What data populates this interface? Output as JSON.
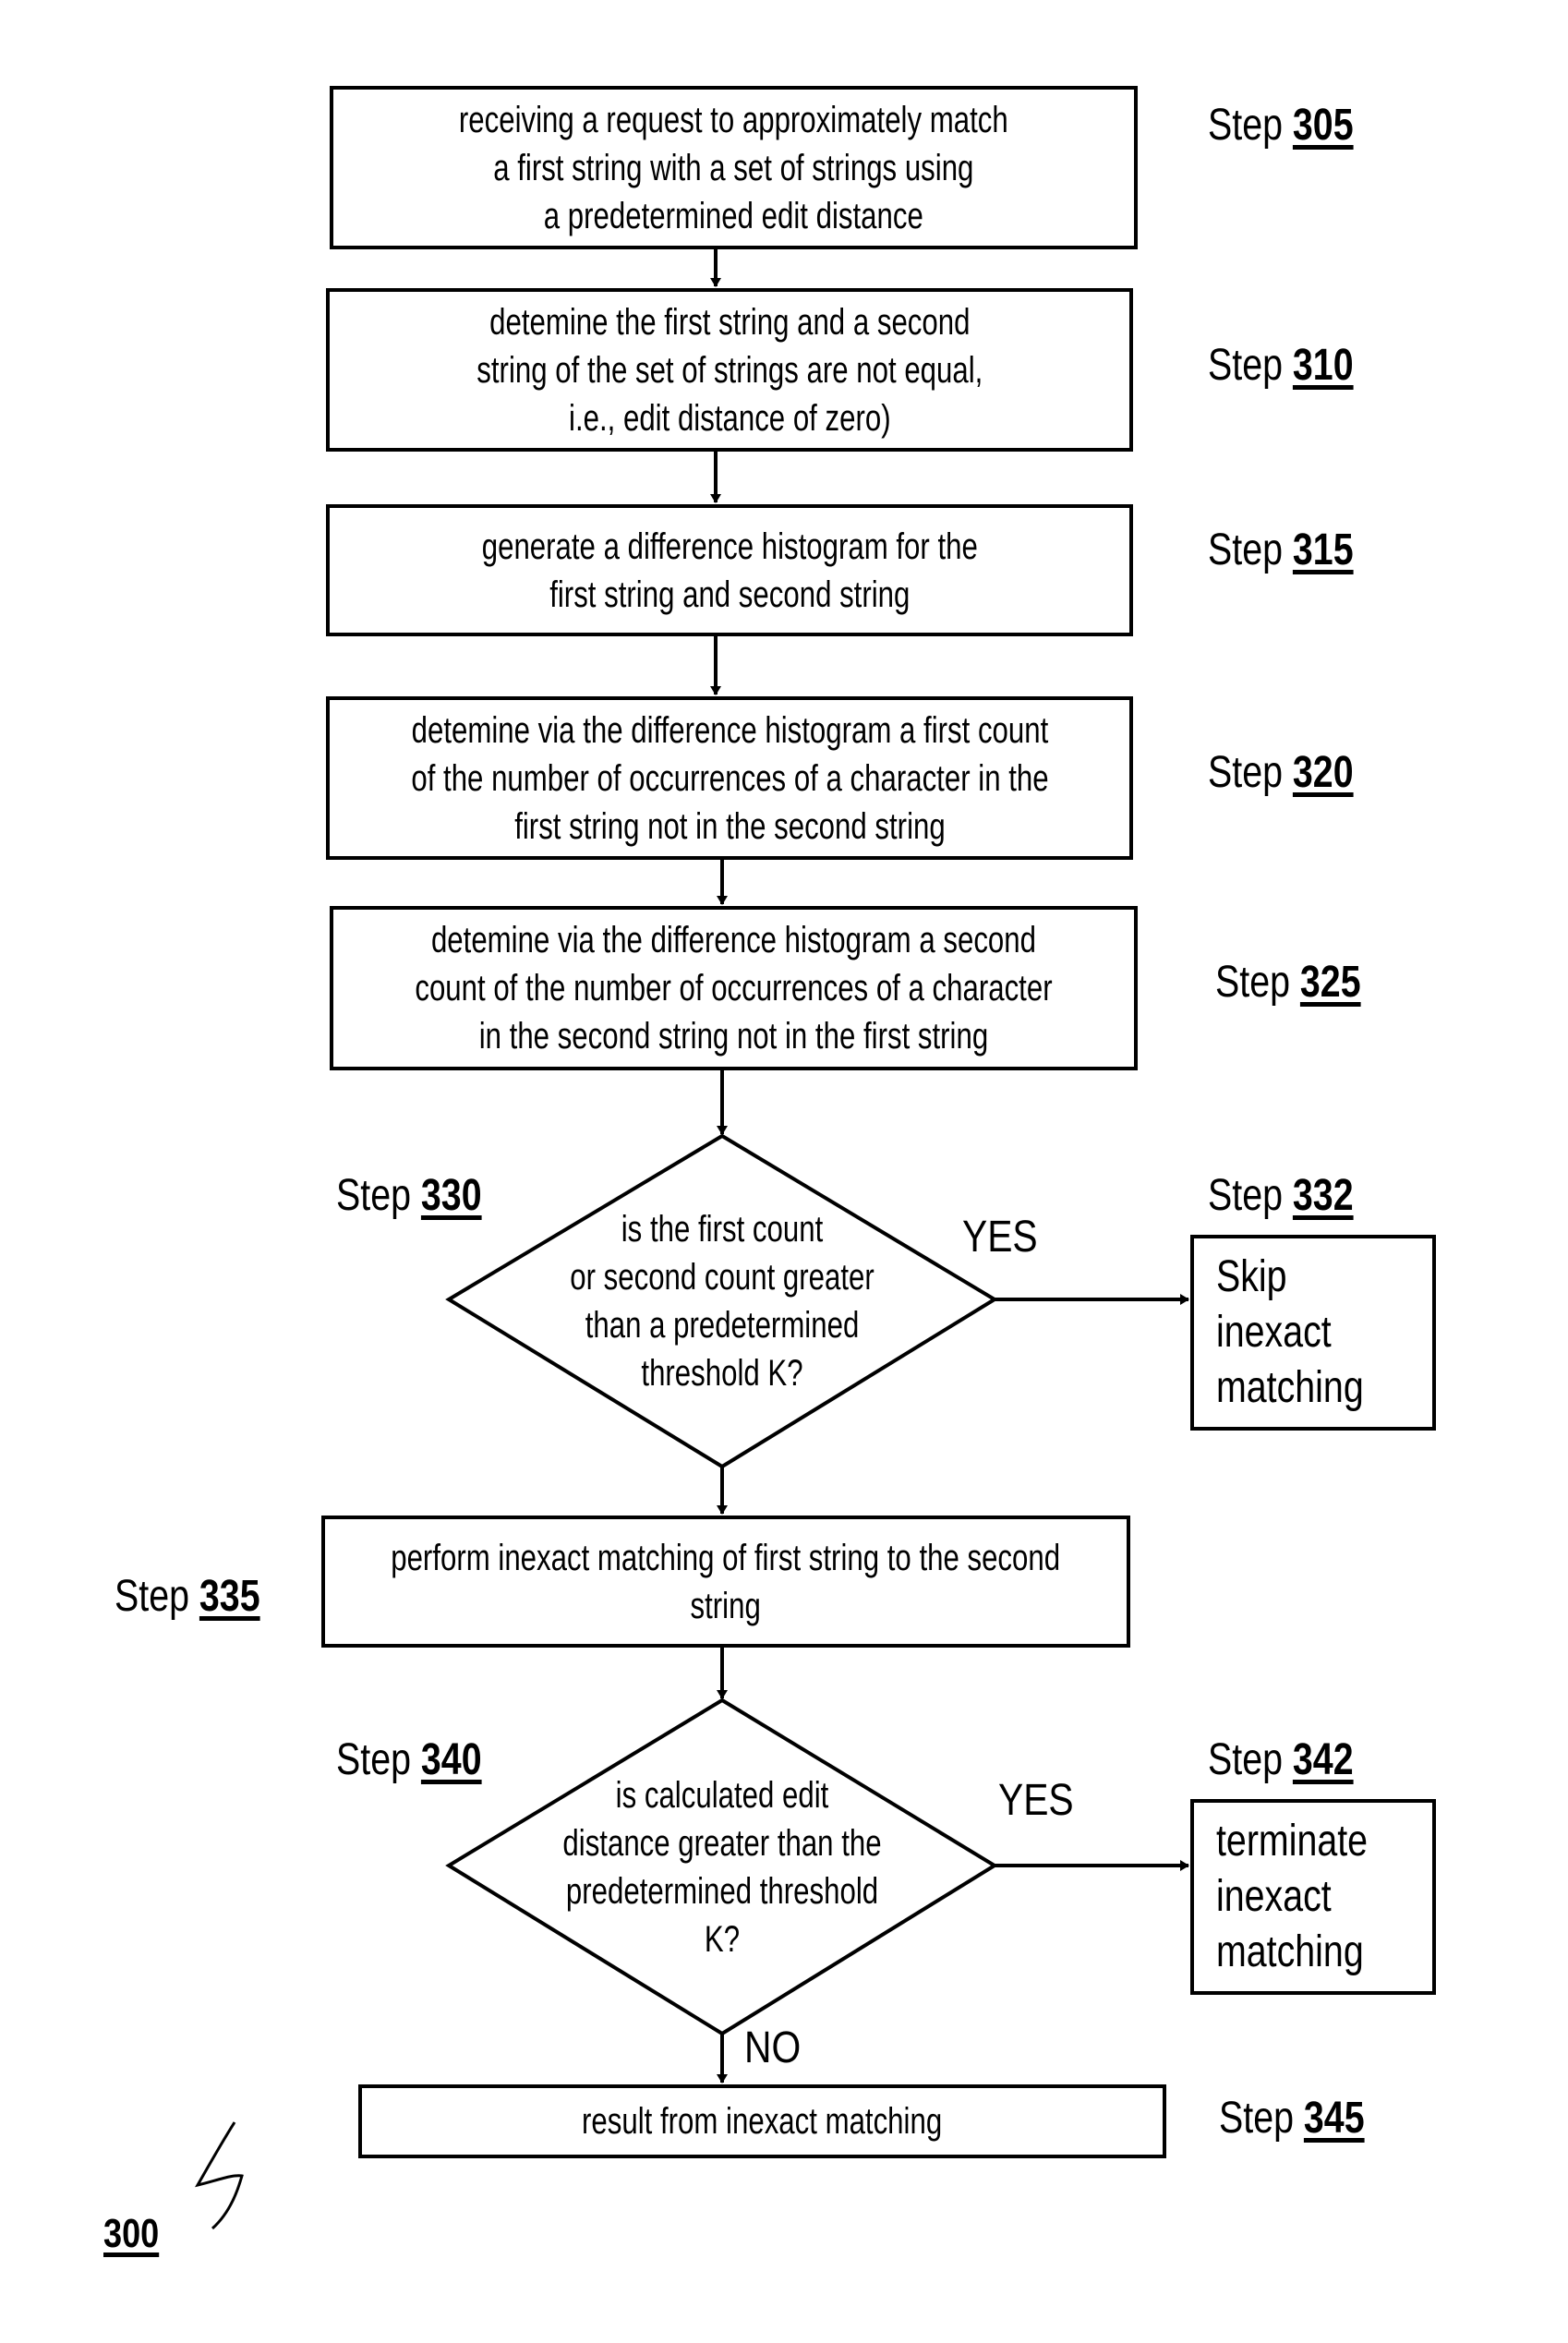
{
  "figure_label": "300",
  "step_prefix": "Step",
  "steps": {
    "s305": {
      "number": "305",
      "lines": [
        "receiving a request to approximately match",
        "a first string with a set of strings using",
        "a predetermined edit distance"
      ]
    },
    "s310": {
      "number": "310",
      "lines": [
        "detemine the first string and a second",
        "string of the set of strings are not equal,",
        "i.e., edit distance of zero)"
      ]
    },
    "s315": {
      "number": "315",
      "lines": [
        "generate a difference histogram for the",
        "first string and second string"
      ]
    },
    "s320": {
      "number": "320",
      "lines": [
        "detemine via the difference histogram a first count",
        "of the number of occurrences of a character in the",
        "first string not in the second string"
      ]
    },
    "s325": {
      "number": "325",
      "lines": [
        "detemine via the difference histogram a second",
        "count of the number of occurrences of a character",
        "in the second string not in the first string"
      ]
    },
    "s330": {
      "number": "330",
      "lines": [
        "is the first count",
        "or second count  greater",
        "than a predetermined",
        "threshold K?"
      ]
    },
    "s332": {
      "number": "332",
      "lines": [
        "Skip",
        "inexact",
        "matching"
      ]
    },
    "s335": {
      "number": "335",
      "lines": [
        "perform inexact matching of first string to the second",
        "string"
      ]
    },
    "s340": {
      "number": "340",
      "lines": [
        "is calculated edit",
        "distance greater than the",
        "predetermined threshold",
        "K?"
      ]
    },
    "s342": {
      "number": "342",
      "lines": [
        "terminate",
        "inexact",
        "matching"
      ]
    },
    "s345": {
      "number": "345",
      "lines": [
        "result from inexact matching"
      ]
    }
  },
  "edge_labels": {
    "yes_330": "YES",
    "yes_340": "YES",
    "no_340": "NO"
  }
}
